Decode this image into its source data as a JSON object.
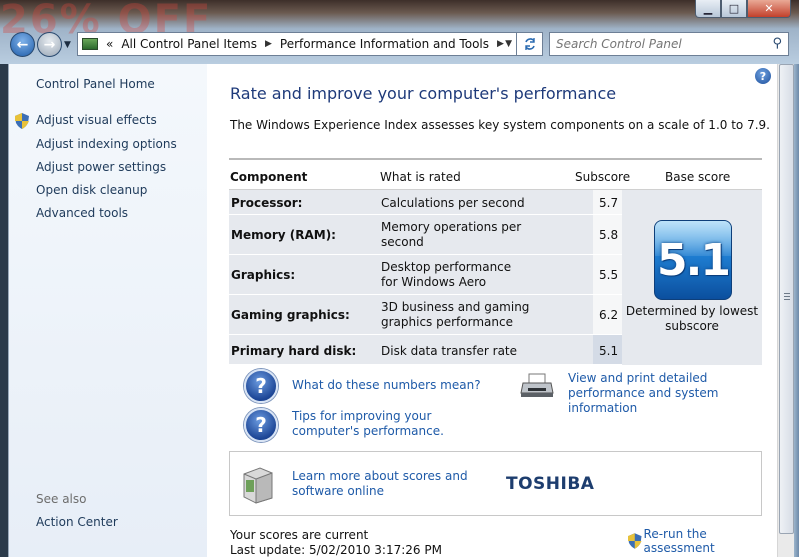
{
  "background_ad": {
    "text": "26% OFF"
  },
  "window": {
    "minimize_glyph": "▁",
    "maximize_glyph": "□",
    "close_glyph": "✕"
  },
  "nav": {
    "back_glyph": "←",
    "forward_glyph": "→",
    "overflow_glyph": "«",
    "breadcrumb": [
      "All Control Panel Items",
      "Performance Information and Tools"
    ],
    "search_placeholder": "Search Control Panel"
  },
  "sidebar": {
    "home": "Control Panel Home",
    "items": [
      {
        "label": "Adjust visual effects",
        "shield": true
      },
      {
        "label": "Adjust indexing options"
      },
      {
        "label": "Adjust power settings"
      },
      {
        "label": "Open disk cleanup"
      },
      {
        "label": "Advanced tools"
      }
    ],
    "see_also_heading": "See also",
    "see_also_items": [
      "Action Center"
    ]
  },
  "main": {
    "title": "Rate and improve your computer's performance",
    "description": "The Windows Experience Index assesses key system components on a scale of 1.0 to 7.9.",
    "table": {
      "headers": {
        "component": "Component",
        "what": "What is rated",
        "subscore": "Subscore",
        "base": "Base score"
      },
      "rows": [
        {
          "component": "Processor:",
          "what": "Calculations per second",
          "subscore": "5.7"
        },
        {
          "component": "Memory (RAM):",
          "what": "Memory operations per second",
          "subscore": "5.8"
        },
        {
          "component": "Graphics:",
          "what": "Desktop performance for Windows Aero",
          "subscore": "5.5"
        },
        {
          "component": "Gaming graphics:",
          "what": "3D business and gaming graphics performance",
          "subscore": "6.2"
        },
        {
          "component": "Primary hard disk:",
          "what": "Disk data transfer rate",
          "subscore": "5.1"
        }
      ],
      "base_score": "5.1",
      "base_caption": "Determined by lowest subscore"
    },
    "links": {
      "numbers": "What do these numbers mean?",
      "tips": "Tips for improving your computer's performance.",
      "view_print": "View and print detailed performance and system information"
    },
    "learn_box": {
      "text": "Learn more about scores and software online",
      "brand": "TOSHIBA"
    },
    "status": "Your scores are current",
    "last_update": "Last update: 5/02/2010 3:17:26 PM",
    "rerun": "Re-run the assessment"
  },
  "colors": {
    "link": "#1e5aa8",
    "title": "#1e3a7a",
    "badge": "#1e7dd1"
  }
}
